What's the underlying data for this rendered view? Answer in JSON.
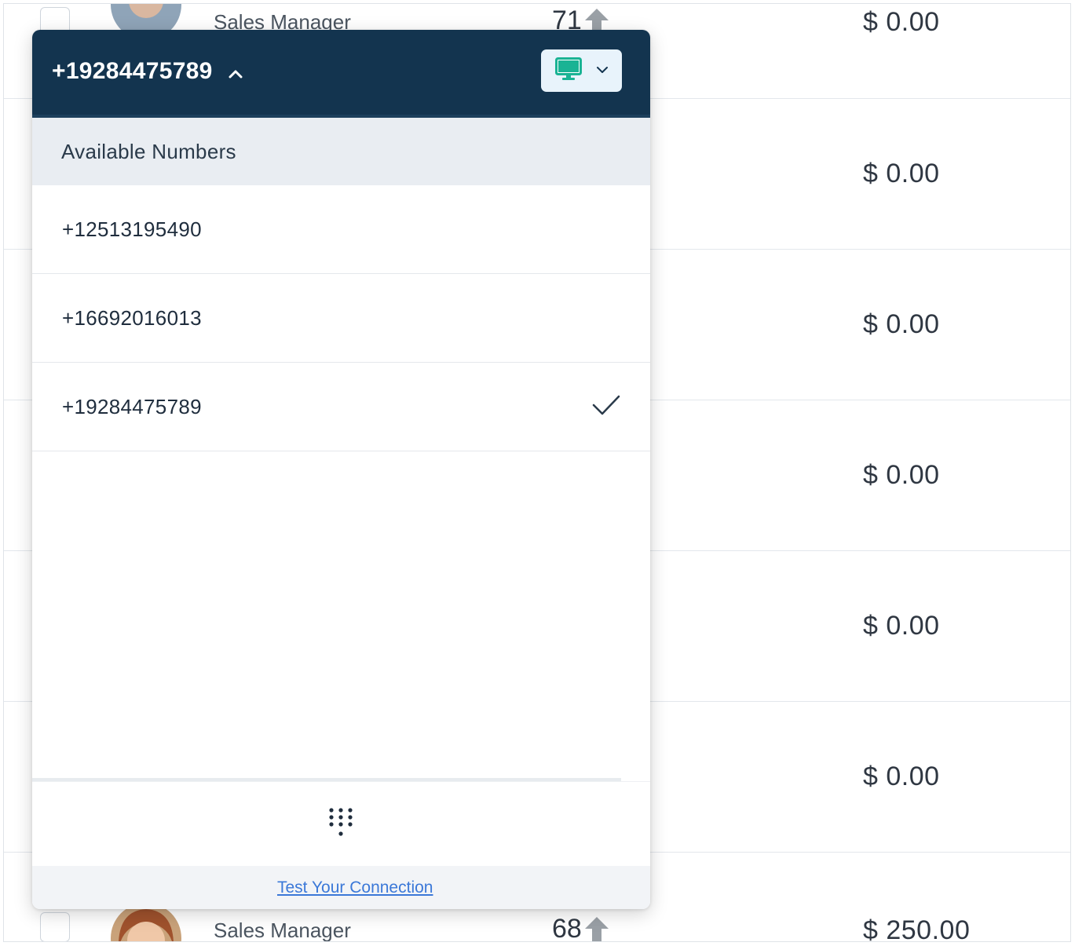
{
  "background_list": {
    "top_row": {
      "role": "Sales Manager",
      "score": "71",
      "amount": "$ 0.00"
    },
    "amounts": [
      "$ 0.00",
      "$ 0.00",
      "$ 0.00",
      "$ 0.00",
      "$ 0.00",
      "$ 0.00"
    ],
    "bottom_row": {
      "role": "Sales Manager",
      "score": "68",
      "amount": "$ 250.00"
    }
  },
  "dialer": {
    "selected_number": "+19284475789",
    "device_icon": "monitor-icon",
    "section_title": "Available Numbers",
    "numbers": [
      {
        "label": "+12513195490",
        "selected": false
      },
      {
        "label": "+16692016013",
        "selected": false
      },
      {
        "label": "+19284475789",
        "selected": true
      }
    ],
    "keypad_icon": "keypad-icon",
    "footer_link": "Test Your Connection"
  },
  "colors": {
    "header_bg": "#13344f",
    "section_bg": "#e9edf2",
    "device_btn_bg": "#e8f3fb",
    "monitor_accent": "#1ab394",
    "link": "#3b78d8"
  }
}
